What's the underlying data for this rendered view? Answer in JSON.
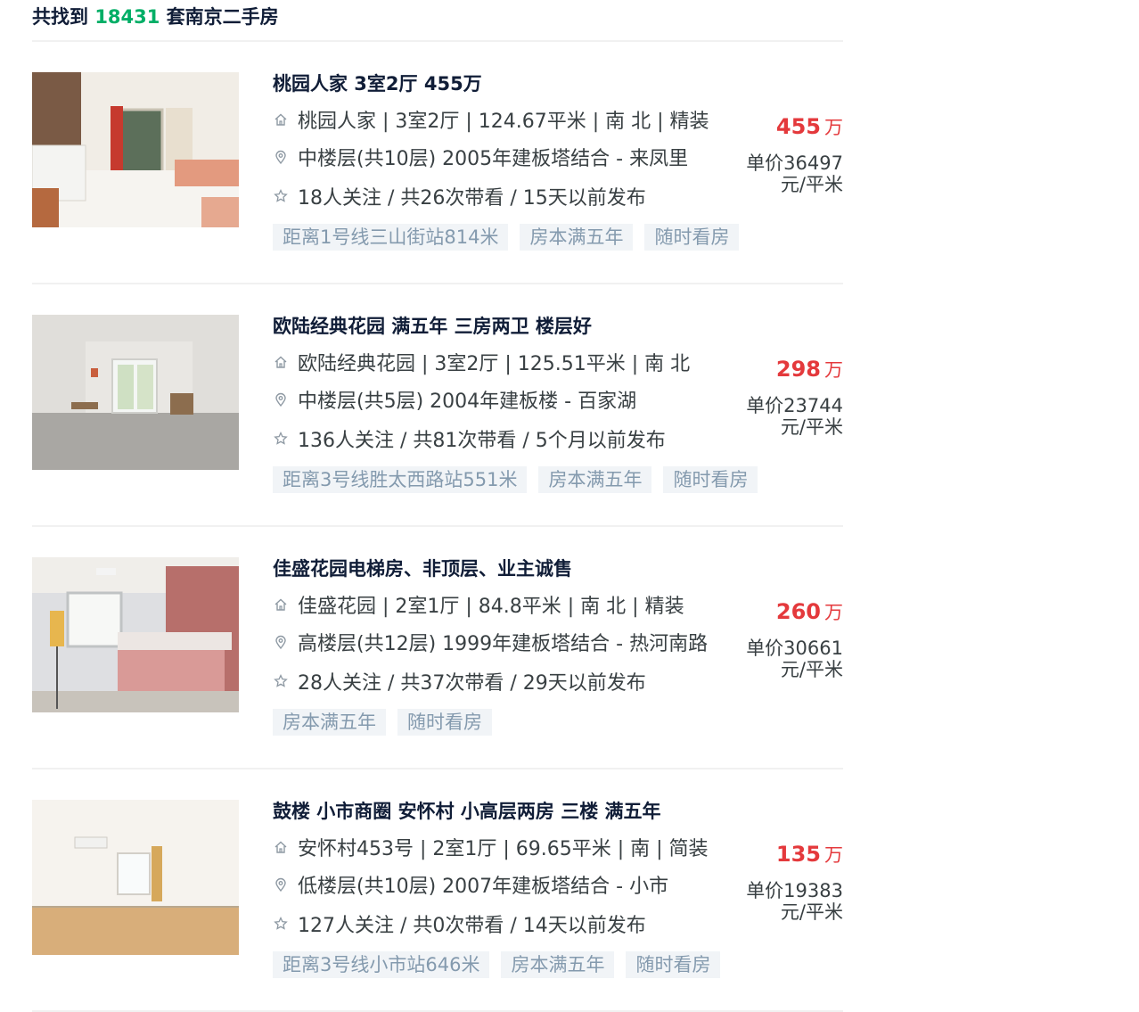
{
  "header": {
    "prefix": "共找到 ",
    "count": "18431",
    "suffix": " 套南京二手房"
  },
  "listings": [
    {
      "title": "桃园人家 3室2厅 455万",
      "house_info": "桃园人家 | 3室2厅 | 124.67平米 | 南 北 | 精装",
      "position_info": "中楼层(共10层) 2005年建板塔结合 - 来凤里",
      "follow_info": "18人关注 / 共26次带看 / 15天以前发布",
      "tags": [
        "距离1号线三山街站814米",
        "房本满五年",
        "随时看房"
      ],
      "price": "455",
      "price_unit": "万",
      "unit_price_line1": "单价36497",
      "unit_price_line2": "元/平米"
    },
    {
      "title": "欧陆经典花园 满五年 三房两卫 楼层好",
      "house_info": "欧陆经典花园 | 3室2厅 | 125.51平米 | 南 北",
      "position_info": "中楼层(共5层) 2004年建板楼 - 百家湖",
      "follow_info": "136人关注 / 共81次带看 / 5个月以前发布",
      "tags": [
        "距离3号线胜太西路站551米",
        "房本满五年",
        "随时看房"
      ],
      "price": "298",
      "price_unit": "万",
      "unit_price_line1": "单价23744",
      "unit_price_line2": "元/平米"
    },
    {
      "title": "佳盛花园电梯房、非顶层、业主诚售",
      "house_info": "佳盛花园 | 2室1厅 | 84.8平米 | 南 北 | 精装",
      "position_info": "高楼层(共12层) 1999年建板塔结合 - 热河南路",
      "follow_info": "28人关注 / 共37次带看 / 29天以前发布",
      "tags": [
        "房本满五年",
        "随时看房"
      ],
      "price": "260",
      "price_unit": "万",
      "unit_price_line1": "单价30661",
      "unit_price_line2": "元/平米"
    },
    {
      "title": "鼓楼 小市商圈 安怀村 小高层两房 三楼 满五年",
      "house_info": "安怀村453号 | 2室1厅 | 69.65平米 | 南 | 简装",
      "position_info": "低楼层(共10层) 2007年建板塔结合 - 小市",
      "follow_info": "127人关注 / 共0次带看 / 14天以前发布",
      "tags": [
        "距离3号线小市站646米",
        "房本满五年",
        "随时看房"
      ],
      "price": "135",
      "price_unit": "万",
      "unit_price_line1": "单价19383",
      "unit_price_line2": "元/平米"
    }
  ],
  "icons": {
    "house": "house-icon",
    "location": "location-pin-icon",
    "follow": "star-icon"
  },
  "colors": {
    "accent_green": "#00ae66",
    "price_red": "#e4393c",
    "tag_bg": "#f1f4f7",
    "tag_text": "#849aae"
  }
}
